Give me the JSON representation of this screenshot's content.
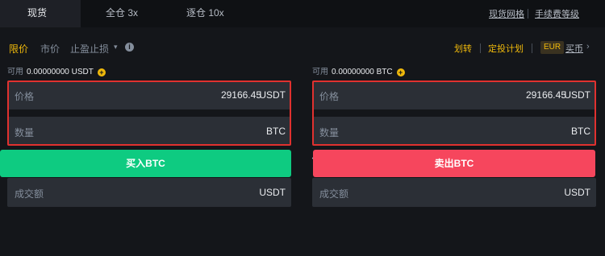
{
  "tabs": [
    {
      "label": "现货"
    },
    {
      "label": "全仓 3x"
    },
    {
      "label": "逐仓 10x"
    }
  ],
  "top_links": {
    "spot_grid": "现货网格",
    "fee_level": "手续费等级"
  },
  "order_types": [
    {
      "label": "限价"
    },
    {
      "label": "市价"
    },
    {
      "label": "止盈止损"
    }
  ],
  "right_links": {
    "transfer": "划转",
    "auto_invest": "定投计划",
    "currency": "EUR",
    "buy_coin": "买币",
    "caret": "▾",
    "chevron": "›"
  },
  "buy_panel": {
    "avail_label": "可用",
    "avail_value": "0.00000000 USDT",
    "price_label": "价格",
    "price_value": "29166.45",
    "price_unit": "USDT",
    "amount_label": "数量",
    "amount_unit": "BTC",
    "total_label": "成交额",
    "total_unit": "USDT",
    "button_label": "买入BTC"
  },
  "sell_panel": {
    "avail_label": "可用",
    "avail_value": "0.00000000 BTC",
    "price_label": "价格",
    "price_value": "29166.45",
    "price_unit": "USDT",
    "amount_label": "数量",
    "amount_unit": "BTC",
    "total_label": "成交额",
    "total_unit": "USDT",
    "button_label": "卖出BTC"
  },
  "colors": {
    "accent": "#f0b90b",
    "buy": "#0ecb81",
    "sell": "#f6465d",
    "highlight_box": "#e0312f"
  },
  "slider_value_percent": 0
}
